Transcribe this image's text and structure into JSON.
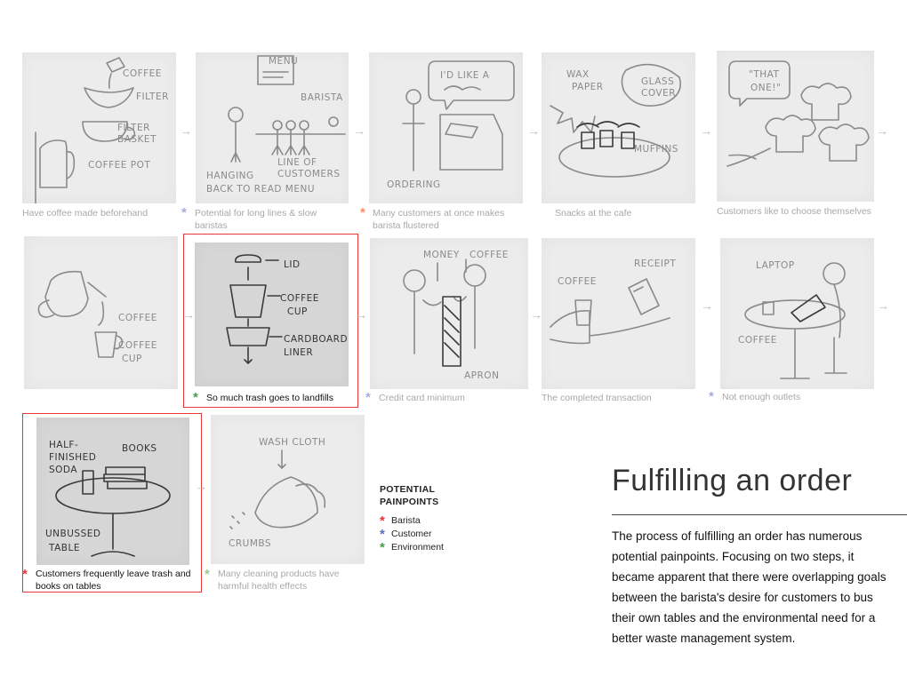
{
  "captions": {
    "c1": "Have coffee made beforehand",
    "c2": "Potential for long lines & slow baristas",
    "c3": "Many customers at once makes barista flustered",
    "c4": "Snacks at the cafe",
    "c5": "Customers like to choose themselves",
    "c6": "So much trash goes to landfills",
    "c7": "Credit card minimum",
    "c8": "The completed transaction",
    "c9": "Not enough outlets",
    "c10": "Customers frequently leave trash and books on tables",
    "c11": "Many cleaning products have harmful health effects"
  },
  "sketch_labels": {
    "n1": {
      "a": "COFFEE",
      "b": "FILTER",
      "c": "FILTER",
      "d": "BASKET",
      "e": "COFFEE POT"
    },
    "n2": {
      "a": "MENU",
      "b": "BARISTA",
      "c": "HANGING",
      "d": "BACK TO READ MENU",
      "e": "LINE OF",
      "f": "CUSTOMERS"
    },
    "n3": {
      "a": "I'D LIKE A",
      "b": "ORDERING"
    },
    "n4": {
      "a": "WAX",
      "b": "PAPER",
      "c": "GLASS",
      "d": "COVER",
      "e": "MUFFINS"
    },
    "n5": {
      "a": "\"THAT",
      "b": "ONE!\""
    },
    "n6": {
      "a": "COFFEE",
      "b": "COFFEE",
      "c": "CUP"
    },
    "n7": {
      "a": "LID",
      "b": "COFFEE",
      "c": "CUP",
      "d": "CARDBOARD",
      "e": "LINER"
    },
    "n8": {
      "a": "MONEY",
      "b": "COFFEE",
      "c": "APRON"
    },
    "n9": {
      "a": "COFFEE",
      "b": "RECEIPT"
    },
    "n10": {
      "a": "LAPTOP",
      "b": "COFFEE"
    },
    "n11": {
      "a": "HALF-",
      "b": "FINISHED",
      "c": "SODA",
      "d": "BOOKS",
      "e": "UNBUSSED",
      "f": "TABLE"
    },
    "n12": {
      "a": "WASH CLOTH",
      "b": "CRUMBS"
    }
  },
  "arrow_glyph": "→",
  "asterisk": "*",
  "legend": {
    "title_line1": "POTENTIAL",
    "title_line2": "PAINPOINTS",
    "items": [
      {
        "label": "Barista",
        "color": "#e53935"
      },
      {
        "label": "Customer",
        "color": "#5c6bc0"
      },
      {
        "label": "Environment",
        "color": "#43a047"
      }
    ]
  },
  "title": "Fulfilling an order",
  "body": "The process of fulfilling an order has numerous potential painpoints. Focusing on two steps, it became apparent that there were overlapping goals between the barista's desire for customers to bus their own tables and the environmental need for a better waste management system."
}
